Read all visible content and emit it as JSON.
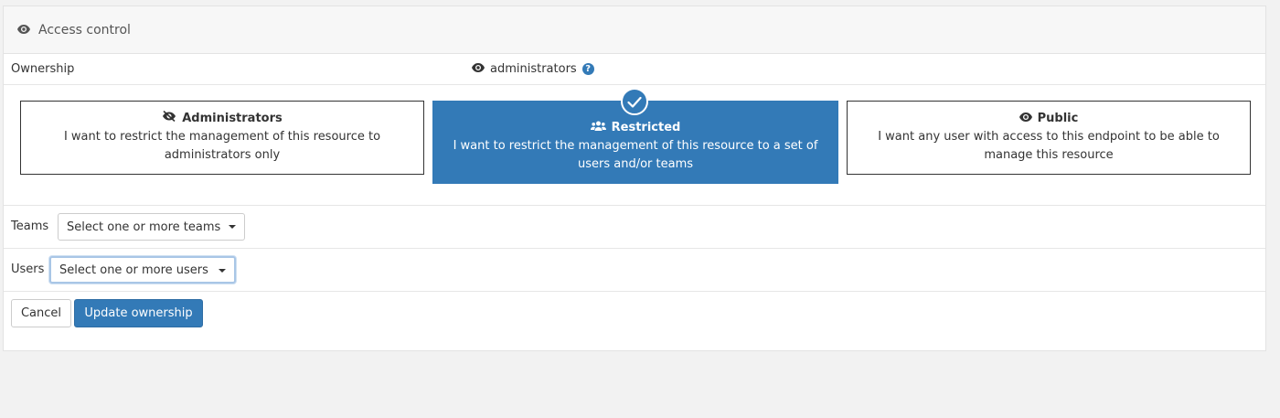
{
  "header": {
    "title": "Access control",
    "icon": "eye-icon"
  },
  "ownership": {
    "label": "Ownership",
    "current_value": "administrators",
    "current_icon": "eye-icon",
    "help_icon": "question-circle-icon",
    "help_glyph": "?"
  },
  "options": {
    "administrators": {
      "title": "Administrators",
      "description": "I want to restrict the management of this resource to administrators only",
      "icon": "eye-slash-icon",
      "selected": false
    },
    "restricted": {
      "title": "Restricted",
      "description": "I want to restrict the management of this resource to a set of users and/or teams",
      "icon": "users-icon",
      "selected": true
    },
    "public": {
      "title": "Public",
      "description": "I want any user with access to this endpoint to be able to manage this resource",
      "icon": "eye-icon",
      "selected": false
    }
  },
  "teams": {
    "label": "Teams",
    "placeholder": "Select one or more teams"
  },
  "users": {
    "label": "Users",
    "placeholder": "Select one or more users"
  },
  "actions": {
    "cancel_label": "Cancel",
    "update_label": "Update ownership"
  },
  "colors": {
    "primary": "#337ab7",
    "border": "#e3e3e3",
    "background": "#f2f2f2"
  }
}
